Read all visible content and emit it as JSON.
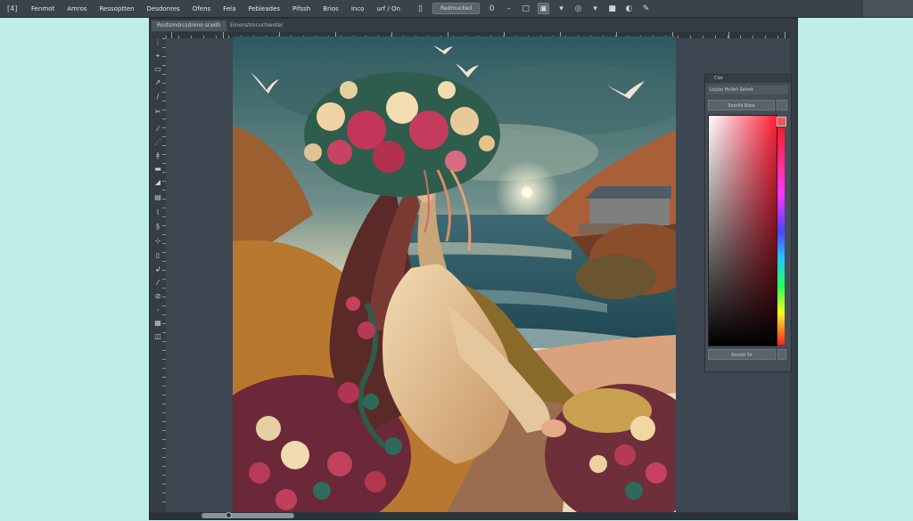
{
  "menubar": {
    "app_label": "[4]",
    "items": [
      "Fenmot",
      "Amros",
      "Ressoptten",
      "Desdonres",
      "Ofens",
      "Fela",
      "Pebleades",
      "Pifssh",
      "Brios",
      "Inco",
      "urf / On"
    ],
    "options": {
      "field1": "Redmucked",
      "zoom_glyph": "0"
    }
  },
  "window": {
    "tabs": [
      {
        "label": "Rostsmdrcsdreno scedh"
      },
      {
        "label": "Emonstrocuchwoter"
      }
    ]
  },
  "artwork": {
    "name": "forest-girl-seaside-painting"
  },
  "color_panel": {
    "title": "Clor",
    "sub_header": "Loybo Hoilell Selrek",
    "field_label": "Soorile Bsse",
    "footer_label": "Sorold Slr",
    "colors": {
      "top_left": "#ffffff",
      "top_right": "#ff1f3a",
      "marker": "#e25b62"
    }
  },
  "scrollbar": {
    "position_fraction": 0.15
  }
}
